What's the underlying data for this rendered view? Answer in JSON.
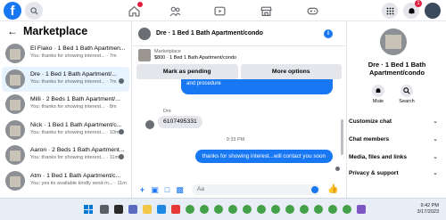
{
  "topbar": {
    "logo_letter": "f",
    "notification_count": "1"
  },
  "sidebar": {
    "title": "Marketplace",
    "conversations": [
      {
        "name": "El Flako · 1 Bed 1 Bath Apartmen...",
        "snippet": "You: thanks for showing interest... · 7m"
      },
      {
        "name": "Dre · 1 Bed 1 Bath Apartment/...",
        "snippet": "You: thanks for showing interest... · 7m"
      },
      {
        "name": "Milli · 2 Beds 1 Bath Apartment/...",
        "snippet": "You: thanks for showing interest... · 8m"
      },
      {
        "name": "Nick · 1 Bed 1 Bath Apartment/c...",
        "snippet": "You: thanks for showing interest... · 10m"
      },
      {
        "name": "Aaron · 2 Beds 1 Bath Apartment...",
        "snippet": "You: thanks for showing interest... · 11m"
      },
      {
        "name": "Atm · 1 Bed 1 Bath Apartment/c...",
        "snippet": "You: yes its available kindly send m... · 11m"
      }
    ]
  },
  "chat": {
    "header_name": "Dre · 1 Bed 1 Bath Apartment/condo",
    "info_glyph": "i",
    "listing_label": "Marketplace",
    "listing_price": "$800 · 1 Bed 1 Bath Apartment/condo",
    "mark_pending_label": "Mark as pending",
    "more_options_label": "More options",
    "prev_message_tail": "and procedure",
    "sender_name": "Dre",
    "incoming_message": "6107495331",
    "timestamp": "9:33 PM",
    "outgoing_message": "thanks for showing interest...will contact you soon",
    "composer_placeholder": "Aa"
  },
  "details": {
    "name": "Dre · 1 Bed 1 Bath Apartment/condo",
    "mute_label": "Mute",
    "search_label": "Search",
    "rows": [
      "Customize chat",
      "Chat members",
      "Media, files and links",
      "Privacy & support"
    ]
  },
  "taskbar": {
    "time": "9:42 PM",
    "date": "3/17/2023"
  }
}
